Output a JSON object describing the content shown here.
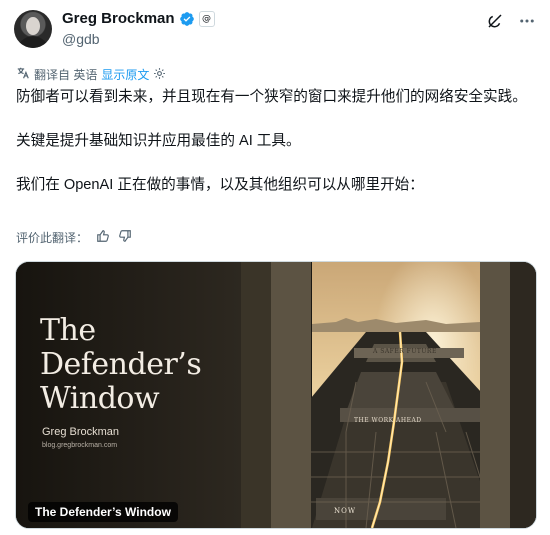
{
  "author": {
    "display_name": "Greg Brockman",
    "handle": "@gdb",
    "org_badge": "@"
  },
  "translation": {
    "translated_from": "翻译自 英语",
    "show_original": "显示原文"
  },
  "tweet": {
    "paragraph_1": "防御者可以看到未来，并且现在有一个狭窄的窗口来提升他们的网络安全实践。",
    "paragraph_2": "关键是提升基础知识并应用最佳的 AI 工具。",
    "paragraph_3": "我们在 OpenAI 正在做的事情，以及其他组织可以从哪里开始："
  },
  "rate_translation": {
    "label": "评价此翻译："
  },
  "media": {
    "title_line_1": "The",
    "title_line_2": "Defender’s",
    "title_line_3": "Window",
    "author_name": "Greg Brockman",
    "blog_url": "blog.gregbrockman.com",
    "sign_future": "A SAFER FUTURE",
    "sign_work": "THE WORK AHEAD",
    "sign_now": "NOW",
    "caption": "The Defender’s Window"
  },
  "icons": {
    "verified": "verified-badge-icon",
    "grok": "grok-icon",
    "more": "more-icon",
    "translate": "translate-icon",
    "settings": "gear-icon",
    "thumbs_up": "thumbs-up-icon",
    "thumbs_down": "thumbs-down-icon"
  },
  "colors": {
    "text": "#0f1419",
    "muted": "#536471",
    "link": "#1d9bf0",
    "verified": "#1d9bf0"
  }
}
